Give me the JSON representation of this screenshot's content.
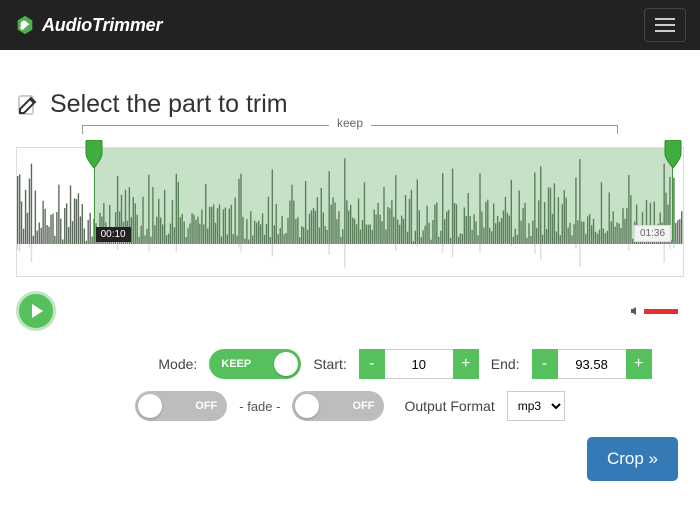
{
  "app": {
    "name": "AudioTrimmer"
  },
  "title": "Select the part to trim",
  "bracket_label": "keep",
  "selection": {
    "start_time_display": "00:10",
    "end_time_display": "01:36",
    "start_seconds": "10",
    "end_seconds": "93.58",
    "start_pct": 11.5,
    "end_pct": 98.5
  },
  "controls": {
    "mode_label": "Mode:",
    "mode_value": "KEEP",
    "start_label": "Start:",
    "end_label": "End:",
    "minus": "-",
    "plus": "+",
    "fade_left_value": "OFF",
    "fade_word": "- fade -",
    "fade_right_value": "OFF",
    "output_format_label": "Output Format",
    "output_format_value": "mp3",
    "crop_label": "Crop »"
  },
  "icons": {
    "edit": "edit-icon",
    "play": "play-icon",
    "volume": "volume-icon",
    "hamburger": "menu-icon"
  }
}
